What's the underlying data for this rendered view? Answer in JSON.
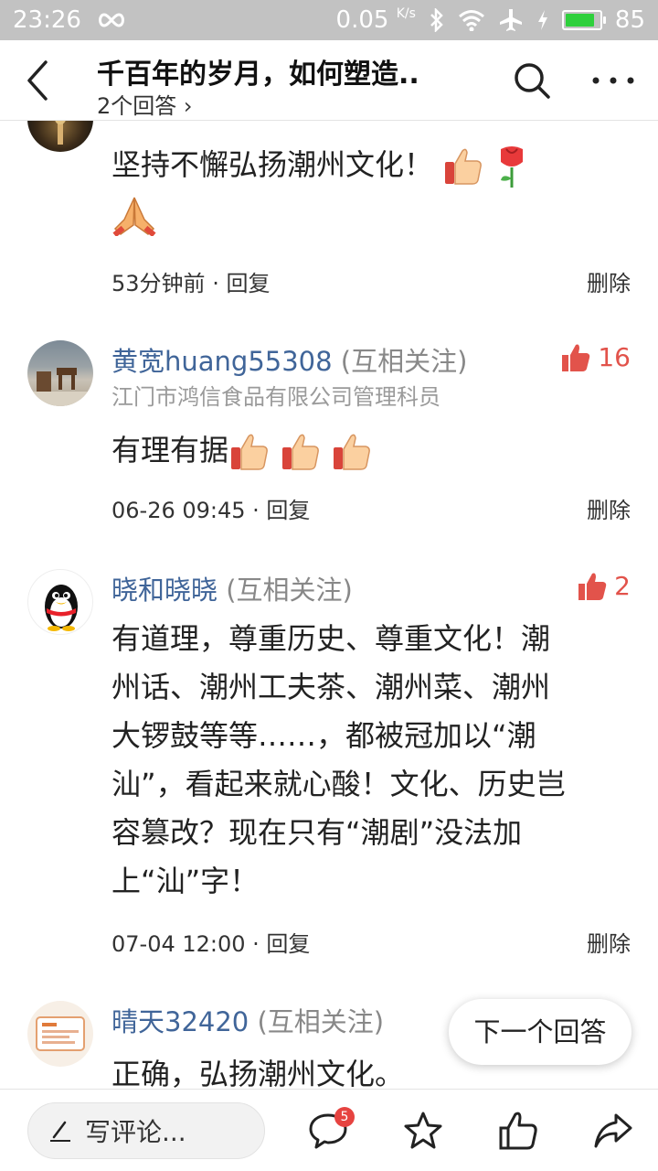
{
  "status_bar": {
    "time": "23:26",
    "speed_value": "0.05",
    "speed_unit": "K/s",
    "battery": "85",
    "battery_color": "#2ed03c"
  },
  "header": {
    "title": "千百年的岁月，如何塑造..",
    "subtitle": "2个回答 ›"
  },
  "comments": [
    {
      "avatar": "dark-photo-avatar",
      "text": "坚持不懈弘扬潮州文化！",
      "time": "53分钟前",
      "reply": "· 回复",
      "delete": "删除"
    },
    {
      "avatar": "room-photo-avatar",
      "name": "黄宽huang55308",
      "follow": "(互相关注)",
      "occupation": "江门市鸿信食品有限公司管理科员",
      "likes": "16",
      "text": "有理有据",
      "time": "06-26 09:45",
      "reply": "· 回复",
      "delete": "删除"
    },
    {
      "avatar": "qq-penguin-avatar",
      "name": "晓和晓晓",
      "follow": "(互相关注)",
      "likes": "2",
      "lines": [
        "有道理，尊重历史、尊重文化！潮",
        "州话、潮州工夫茶、潮州菜、潮州",
        "大锣鼓等等……，都被冠加以“潮",
        "汕”，看起来就心酸！文化、历史岂",
        "容篡改？现在只有“潮剧”没法加",
        "上“汕”字！"
      ],
      "time": "07-04 12:00",
      "reply": "· 回复",
      "delete": "删除"
    },
    {
      "avatar": "logo-avatar",
      "name": "晴天32420",
      "follow": "(互相关注)",
      "text": "正确，弘扬潮州文化。"
    }
  ],
  "next_answer": "下一个回答",
  "bottom_bar": {
    "write_placeholder": "写评论...",
    "comment_count": "5"
  },
  "colors": {
    "name_blue": "#406599",
    "like_red": "#e2534b",
    "badge_red": "#e64340"
  }
}
